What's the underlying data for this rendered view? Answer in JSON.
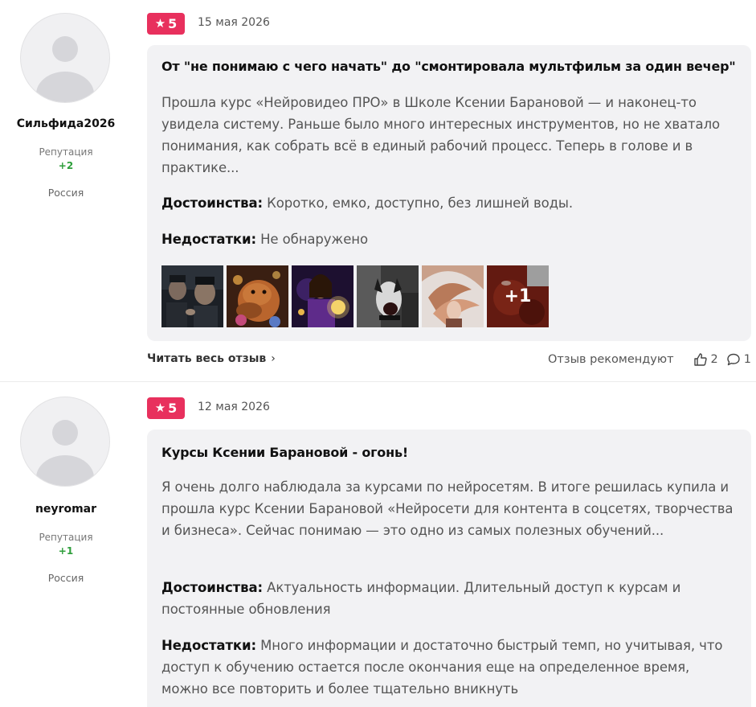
{
  "reviews": [
    {
      "user": {
        "name": "Сильфида2026",
        "reputation_label": "Репутация",
        "reputation_value": "+2",
        "country": "Россия"
      },
      "rating": "5",
      "date": "15 мая 2026",
      "title": "От \"не понимаю с чего начать\" до \"смонтировала мультфильм за один вечер\"",
      "body": "Прошла курс «Нейровидео ПРО» в Школе Ксении Барановой — и наконец-то увидела систему. Раньше было много интересных инструментов, но не хватало понимания, как собрать всё в единый рабочий процесс. Теперь в голове и в практике...",
      "pros_label": "Достоинства:",
      "pros": "Коротко, емко, доступно, без лишней воды.",
      "cons_label": "Недостатки:",
      "cons": "Не обнаружено",
      "more_photos": "+1",
      "read_more": "Читать весь отзыв",
      "recommend_label": "Отзыв рекомендуют",
      "likes": "2",
      "comments": "1"
    },
    {
      "user": {
        "name": "neyromar",
        "reputation_label": "Репутация",
        "reputation_value": "+1",
        "country": "Россия"
      },
      "rating": "5",
      "date": "12 мая 2026",
      "title": "Курсы Ксении Барановой - огонь!",
      "body": "Я очень долго наблюдала за курсами по нейросетям. В итоге решилась купила и прошла курс Ксении Барановой «Нейросети для контента в соцсетях, творчества и бизнеса». Сейчас понимаю — это одно из самых полезных обучений...",
      "pros_label": "Достоинства:",
      "pros": "Актуальность информации. Длительный доступ к курсам и постоянные обновления",
      "cons_label": "Недостатки:",
      "cons": "Много информации и достаточно быстрый темп, но учитывая, что доступ к обучению остается после окончания еще на определенное время, можно все повторить и более тщательно вникнуть"
    }
  ],
  "colors": {
    "badge": "#e8305d",
    "reputation": "#2d9e3a",
    "card_bg": "#f2f2f4"
  },
  "icons": {
    "star": "star-icon",
    "chevron": "chevron-right-icon",
    "like": "thumbs-up-icon",
    "comment": "comment-icon",
    "avatar": "default-avatar-icon"
  }
}
